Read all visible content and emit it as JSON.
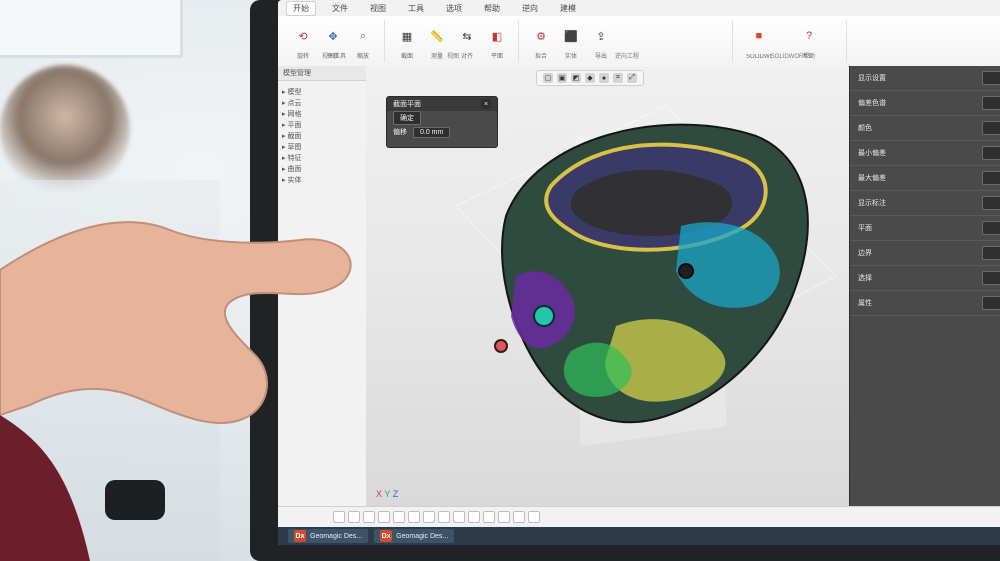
{
  "window": {
    "tabs": [
      "开始",
      "文件",
      "视图",
      "工具",
      "选项",
      "帮助",
      "逆向",
      "建模"
    ],
    "active_tab_index": 0
  },
  "ribbon": {
    "groups": [
      {
        "caption": "视图工具"
      },
      {
        "caption": "视图"
      },
      {
        "caption": "逆向工程"
      },
      {
        "caption": "SOLIDWORKS"
      }
    ],
    "buttons": [
      {
        "label": "旋转",
        "icon": "rotate-icon"
      },
      {
        "label": "平移",
        "icon": "pan-icon"
      },
      {
        "label": "缩放",
        "icon": "zoom-icon"
      },
      {
        "label": "截面",
        "icon": "section-icon"
      },
      {
        "label": "测量",
        "icon": "ruler-icon"
      },
      {
        "label": "对齐",
        "icon": "align-icon"
      },
      {
        "label": "平面",
        "icon": "plane-icon"
      },
      {
        "label": "拟合",
        "icon": "fit-icon"
      },
      {
        "label": "实体",
        "icon": "solid-icon"
      },
      {
        "label": "导出",
        "icon": "export-icon"
      },
      {
        "label": "SOLIDWORKS",
        "icon": "solidworks-icon"
      },
      {
        "label": "帮助",
        "icon": "help-icon"
      }
    ]
  },
  "left_panel": {
    "header": "模型管理",
    "items": [
      "▸ 模型",
      "▸ 点云",
      "▸ 网格",
      "▸ 平面",
      "▸ 截面",
      "▸ 草图",
      "▸ 特征",
      "▸ 曲面",
      "▸ 实体"
    ]
  },
  "viewport": {
    "dialog": {
      "title": "截面平面",
      "button_primary": "确定",
      "field_label": "偏移",
      "field_value": "0.0 mm"
    },
    "axis": {
      "x": "X",
      "y": "Y",
      "z": "Z"
    }
  },
  "right_panel": {
    "rows": [
      "显示设置",
      "偏差色谱",
      "颜色",
      "最小偏差",
      "最大偏差",
      "显示标注",
      "平面",
      "边界",
      "选择",
      "属性"
    ]
  },
  "taskbar": {
    "items": [
      {
        "badge": "Dx",
        "label": "Geomagic Des..."
      },
      {
        "badge": "Dx",
        "label": "Geomagic Des..."
      }
    ]
  },
  "colors": {
    "monitor_bezel": "#1f2326",
    "right_panel": "#4a4a4a",
    "taskbar": "#2e3b4a",
    "accent": "#d24b2f"
  }
}
